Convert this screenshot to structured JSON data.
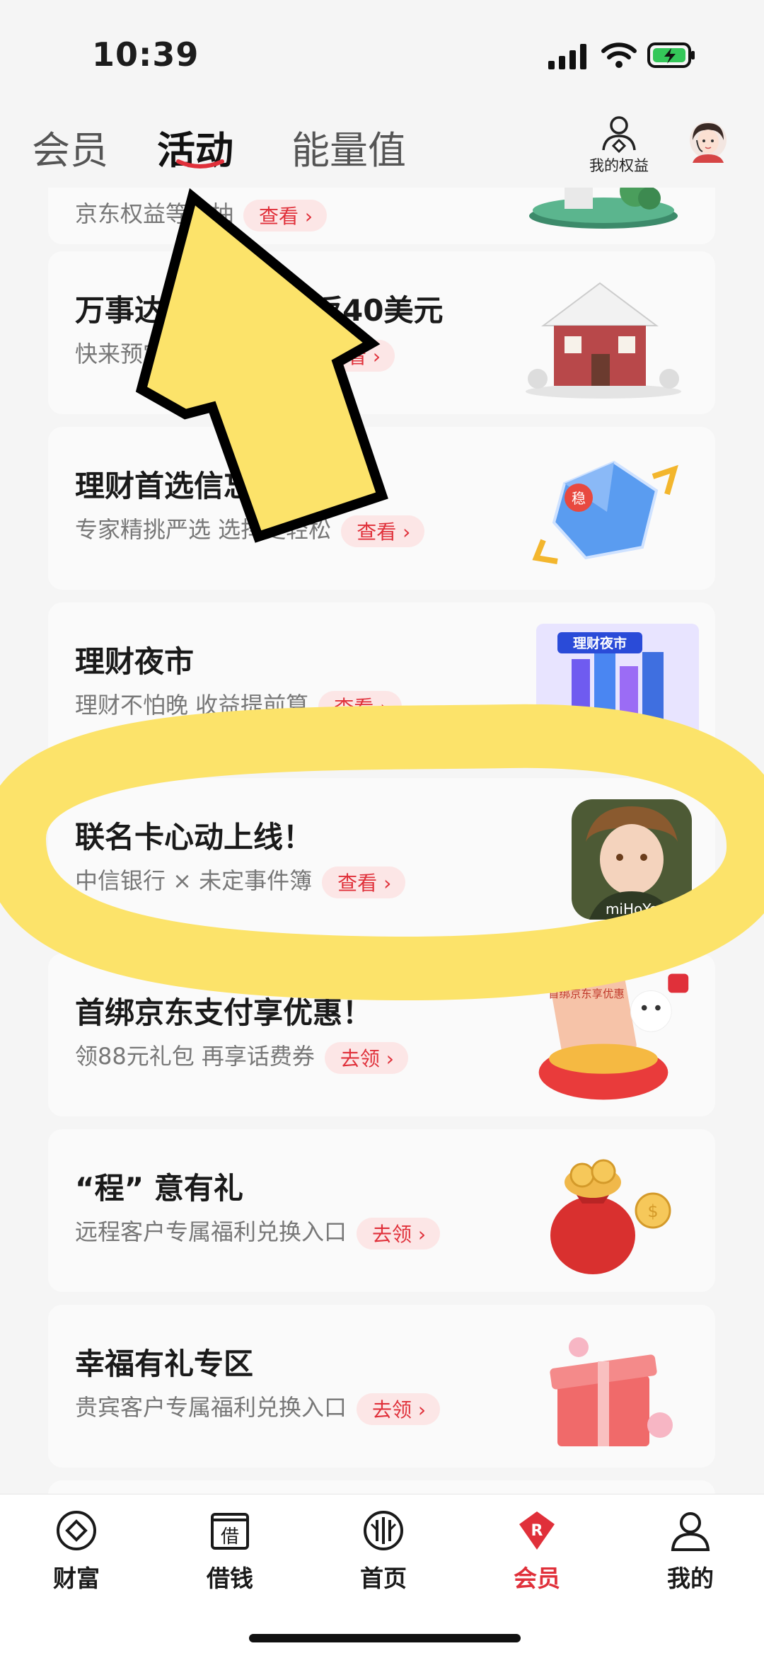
{
  "status": {
    "time": "10:39"
  },
  "top_nav": {
    "tabs": [
      {
        "label": "会员"
      },
      {
        "label": "活动"
      },
      {
        "label": "能量值"
      }
    ],
    "rights_label": "我的权益"
  },
  "cards": [
    {
      "title": "",
      "subtitle": "京东权益等你抽",
      "button": "查看",
      "image": "island-illustration"
    },
    {
      "title": "万事达卡境外最高返40美元",
      "subtitle": "快来预定境外酒店民宿",
      "button": "查看",
      "image": "house-illustration"
    },
    {
      "title": "理财首选信忘",
      "subtitle": "专家精挑严选  选择更轻松",
      "button": "查看",
      "image": "stable-gem-illustration"
    },
    {
      "title": "理财夜市",
      "subtitle": "理财不怕晚 收益提前算",
      "button": "查看",
      "image": "night-market-illustration",
      "image_text": "理财夜市"
    },
    {
      "title": "联名卡心动上线！",
      "subtitle": "中信银行 × 未定事件簿",
      "button": "查看",
      "image": "game-character-illustration",
      "image_text": "miHoYo"
    },
    {
      "title": "首绑京东支付享优惠！",
      "subtitle": "领88元礼包  再享话费券",
      "button": "去领",
      "image": "jd-gift-illustration",
      "image_text": "首绑京东享优惠"
    },
    {
      "title": "“程” 意有礼",
      "subtitle": "远程客户专属福利兑换入口",
      "button": "去领",
      "image": "money-bag-illustration"
    },
    {
      "title": "幸福有礼专区",
      "subtitle": "贵宾客户专属福利兑换入口",
      "button": "去领",
      "image": "gift-box-illustration"
    }
  ],
  "bottom_nav": [
    {
      "label": "财富",
      "icon": "wealth-icon"
    },
    {
      "label": "借钱",
      "icon": "borrow-icon",
      "glyph": "借"
    },
    {
      "label": "首页",
      "icon": "home-icon"
    },
    {
      "label": "会员",
      "icon": "member-icon",
      "active": true
    },
    {
      "label": "我的",
      "icon": "profile-icon"
    }
  ],
  "colors": {
    "accent": "#e0303a",
    "overlay_yellow": "#fce36a",
    "button_bg": "#fce6e6"
  }
}
